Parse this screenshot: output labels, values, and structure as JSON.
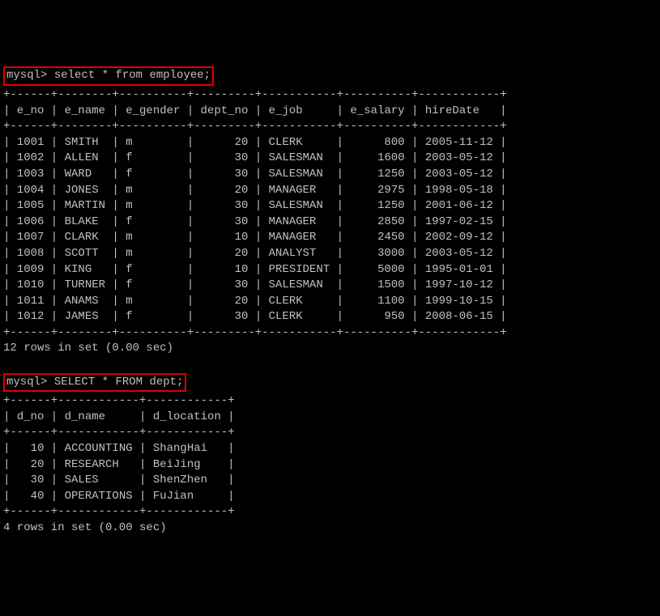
{
  "queries": [
    {
      "prompt": "mysql>",
      "sql": "select * from employee;",
      "highlighted": true,
      "separator": "+------+--------+----------+---------+-----------+----------+------------+",
      "header": "| e_no | e_name | e_gender | dept_no | e_job     | e_salary | hireDate   |",
      "rows": [
        "| 1001 | SMITH  | m        |      20 | CLERK     |      800 | 2005-11-12 |",
        "| 1002 | ALLEN  | f        |      30 | SALESMAN  |     1600 | 2003-05-12 |",
        "| 1003 | WARD   | f        |      30 | SALESMAN  |     1250 | 2003-05-12 |",
        "| 1004 | JONES  | m        |      20 | MANAGER   |     2975 | 1998-05-18 |",
        "| 1005 | MARTIN | m        |      30 | SALESMAN  |     1250 | 2001-06-12 |",
        "| 1006 | BLAKE  | f        |      30 | MANAGER   |     2850 | 1997-02-15 |",
        "| 1007 | CLARK  | m        |      10 | MANAGER   |     2450 | 2002-09-12 |",
        "| 1008 | SCOTT  | m        |      20 | ANALYST   |     3000 | 2003-05-12 |",
        "| 1009 | KING   | f        |      10 | PRESIDENT |     5000 | 1995-01-01 |",
        "| 1010 | TURNER | f        |      30 | SALESMAN  |     1500 | 1997-10-12 |",
        "| 1011 | ANAMS  | m        |      20 | CLERK     |     1100 | 1999-10-15 |",
        "| 1012 | JAMES  | f        |      30 | CLERK     |      950 | 2008-06-15 |"
      ],
      "footer": "12 rows in set (0.00 sec)"
    },
    {
      "prompt": "mysql>",
      "sql": "SELECT * FROM dept;",
      "highlighted": true,
      "separator": "+------+------------+------------+",
      "header": "| d_no | d_name     | d_location |",
      "rows": [
        "|   10 | ACCOUNTING | ShangHai   |",
        "|   20 | RESEARCH   | BeiJing    |",
        "|   30 | SALES      | ShenZhen   |",
        "|   40 | OPERATIONS | FuJian     |"
      ],
      "footer": "4 rows in set (0.00 sec)"
    }
  ],
  "chart_data": [
    {
      "type": "table",
      "title": "employee",
      "columns": [
        "e_no",
        "e_name",
        "e_gender",
        "dept_no",
        "e_job",
        "e_salary",
        "hireDate"
      ],
      "rows": [
        [
          1001,
          "SMITH",
          "m",
          20,
          "CLERK",
          800,
          "2005-11-12"
        ],
        [
          1002,
          "ALLEN",
          "f",
          30,
          "SALESMAN",
          1600,
          "2003-05-12"
        ],
        [
          1003,
          "WARD",
          "f",
          30,
          "SALESMAN",
          1250,
          "2003-05-12"
        ],
        [
          1004,
          "JONES",
          "m",
          20,
          "MANAGER",
          2975,
          "1998-05-18"
        ],
        [
          1005,
          "MARTIN",
          "m",
          30,
          "SALESMAN",
          1250,
          "2001-06-12"
        ],
        [
          1006,
          "BLAKE",
          "f",
          30,
          "MANAGER",
          2850,
          "1997-02-15"
        ],
        [
          1007,
          "CLARK",
          "m",
          10,
          "MANAGER",
          2450,
          "2002-09-12"
        ],
        [
          1008,
          "SCOTT",
          "m",
          20,
          "ANALYST",
          3000,
          "2003-05-12"
        ],
        [
          1009,
          "KING",
          "f",
          10,
          "PRESIDENT",
          5000,
          "1995-01-01"
        ],
        [
          1010,
          "TURNER",
          "f",
          30,
          "SALESMAN",
          1500,
          "1997-10-12"
        ],
        [
          1011,
          "ANAMS",
          "m",
          20,
          "CLERK",
          1100,
          "1999-10-15"
        ],
        [
          1012,
          "JAMES",
          "f",
          30,
          "CLERK",
          950,
          "2008-06-15"
        ]
      ]
    },
    {
      "type": "table",
      "title": "dept",
      "columns": [
        "d_no",
        "d_name",
        "d_location"
      ],
      "rows": [
        [
          10,
          "ACCOUNTING",
          "ShangHai"
        ],
        [
          20,
          "RESEARCH",
          "BeiJing"
        ],
        [
          30,
          "SALES",
          "ShenZhen"
        ],
        [
          40,
          "OPERATIONS",
          "FuJian"
        ]
      ]
    }
  ]
}
